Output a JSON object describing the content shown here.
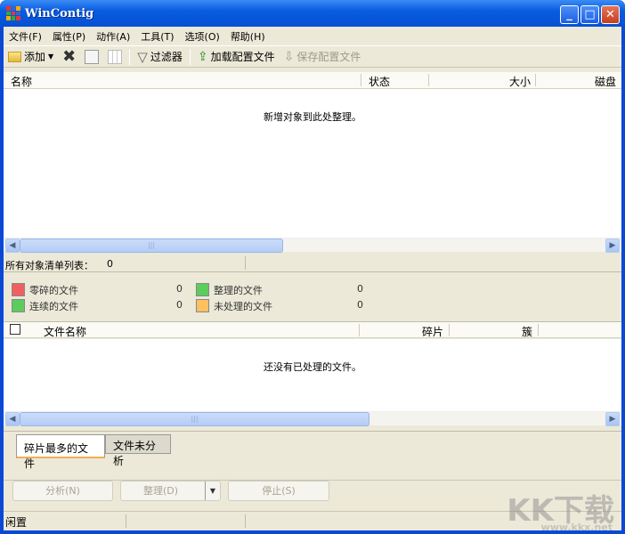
{
  "window": {
    "title": "WinContig"
  },
  "menu": [
    "文件(F)",
    "属性(P)",
    "动作(A)",
    "工具(T)",
    "选项(O)",
    "帮助(H)"
  ],
  "toolbar": {
    "add": "添加",
    "filter": "过滤器",
    "load_profile": "加载配置文件",
    "save_profile": "保存配置文件"
  },
  "object_list": {
    "columns": [
      "名称",
      "状态",
      "大小",
      "磁盘"
    ],
    "empty_text": "新增对象到此处整理。"
  },
  "summary": {
    "label": "所有对象清单列表：",
    "count": "0"
  },
  "legend": [
    {
      "label": "零碎的文件",
      "value": "0",
      "color": "#f06060"
    },
    {
      "label": "整理的文件",
      "value": "0",
      "color": "#5ccc5c"
    },
    {
      "label": "连续的文件",
      "value": "0",
      "color": "#5ccc5c"
    },
    {
      "label": "未处理的文件",
      "value": "0",
      "color": "#ffc060"
    }
  ],
  "file_list": {
    "columns": [
      "文件名称",
      "碎片",
      "簇"
    ],
    "empty_text": "还没有已处理的文件。"
  },
  "tabs": [
    "碎片最多的文件",
    "文件未分析"
  ],
  "buttons": {
    "analyze": "分析(N)",
    "defrag": "整理(D)",
    "stop": "停止(S)"
  },
  "status": {
    "text": "闲置"
  },
  "watermark": {
    "logo": "KK下载",
    "url": "www.kkx.net"
  }
}
